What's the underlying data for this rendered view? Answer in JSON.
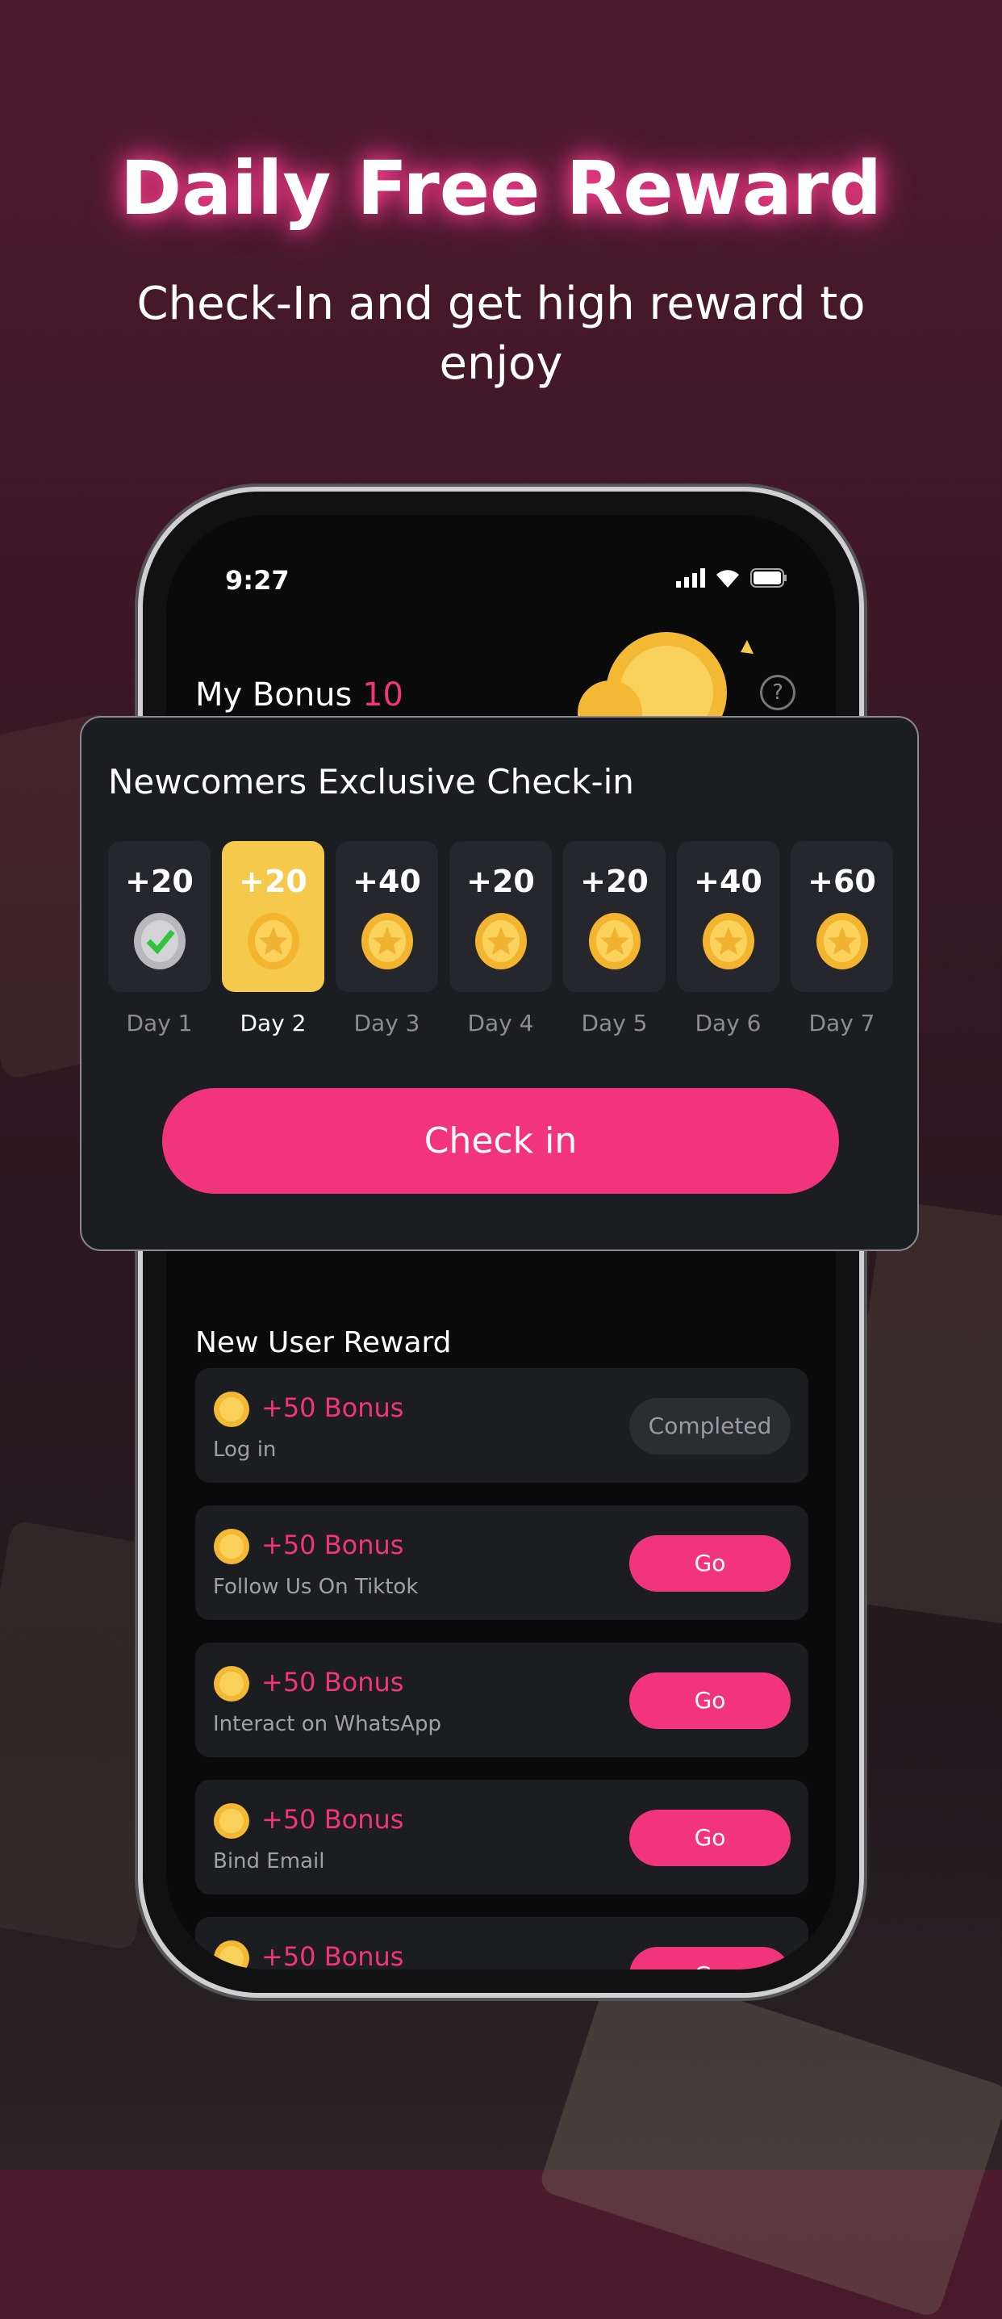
{
  "hero": {
    "title": "Daily Free Reward",
    "subtitle": "Check-In and get high reward to enjoy"
  },
  "status": {
    "time": "9:27"
  },
  "bonus": {
    "label": "My Bonus",
    "value": "10"
  },
  "colors": {
    "accent": "#f2357a",
    "gold": "#f5c94c",
    "card": "#1c1d21"
  },
  "checkin": {
    "title": "Newcomers Exclusive Check-in",
    "button": "Check in",
    "days": [
      {
        "amount": "+20",
        "label": "Day 1",
        "state": "checked"
      },
      {
        "amount": "+20",
        "label": "Day 2",
        "state": "current"
      },
      {
        "amount": "+40",
        "label": "Day 3",
        "state": "upcoming"
      },
      {
        "amount": "+20",
        "label": "Day 4",
        "state": "upcoming"
      },
      {
        "amount": "+20",
        "label": "Day 5",
        "state": "upcoming"
      },
      {
        "amount": "+40",
        "label": "Day 6",
        "state": "upcoming"
      },
      {
        "amount": "+60",
        "label": "Day 7",
        "state": "upcoming"
      }
    ]
  },
  "new_user": {
    "title": "New User Reward",
    "items": [
      {
        "bonus": "+50 Bonus",
        "task": "Log in",
        "action": "Completed"
      },
      {
        "bonus": "+50 Bonus",
        "task": "Follow Us On Tiktok",
        "action": "Go"
      },
      {
        "bonus": "+50 Bonus",
        "task": "Interact on WhatsApp",
        "action": "Go"
      },
      {
        "bonus": "+50 Bonus",
        "task": "Bind Email",
        "action": "Go"
      },
      {
        "bonus": "+50 Bonus",
        "task": "",
        "action": "Go"
      }
    ]
  }
}
